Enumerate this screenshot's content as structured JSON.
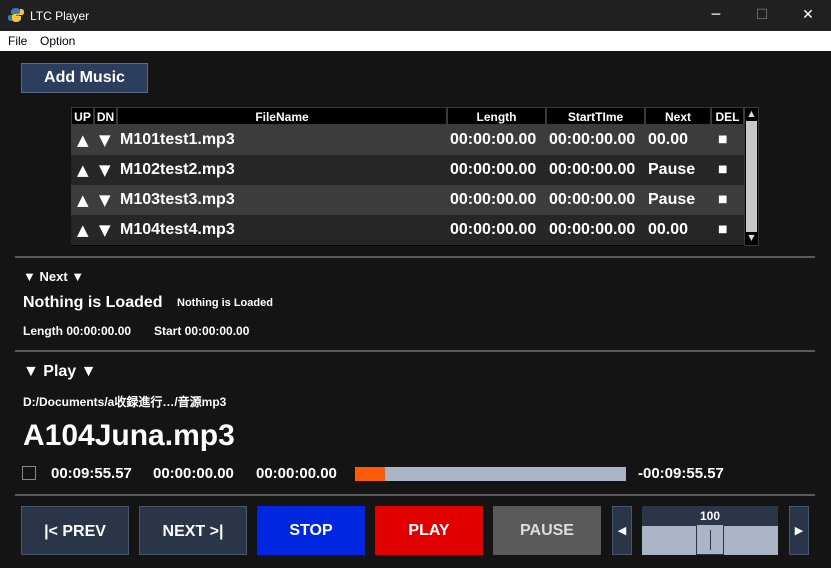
{
  "window": {
    "title": "LTC Player",
    "minimize_glyph": "─",
    "maximize_glyph": "☐",
    "close_glyph": "✕"
  },
  "menu": {
    "file": "File",
    "option": "Option"
  },
  "add_music_label": "Add Music",
  "table": {
    "headers": {
      "up": "UP",
      "dn": "DN",
      "filename": "FileName",
      "length": "Length",
      "start_time": "StartTIme",
      "next": "Next",
      "del": "DEL"
    },
    "up_glyph": "▲",
    "dn_glyph": "▼",
    "del_glyph": "■",
    "rows": [
      {
        "filename": "M101test1.mp3",
        "length": "00:00:00.00",
        "start_time": "00:00:00.00",
        "next": "00.00"
      },
      {
        "filename": "M102test2.mp3",
        "length": "00:00:00.00",
        "start_time": "00:00:00.00",
        "next": "Pause"
      },
      {
        "filename": "M103test3.mp3",
        "length": "00:00:00.00",
        "start_time": "00:00:00.00",
        "next": "Pause"
      },
      {
        "filename": "M104test4.mp3",
        "length": "00:00:00.00",
        "start_time": "00:00:00.00",
        "next": "00.00"
      }
    ]
  },
  "next_section": {
    "header": "▼ Next ▼",
    "title": "Nothing is Loaded",
    "subtitle": "Nothing is Loaded",
    "length_text": "Length 00:00:00.00",
    "start_text": "Start 00:00:00.00"
  },
  "play_section": {
    "header": "▼ Play ▼",
    "path": "D:/Documents/a收録進行…/音源mp3",
    "current_file": "A104Juna.mp3",
    "time_total": "00:09:55.57",
    "time_a": "00:00:00.00",
    "time_b": "00:00:00.00",
    "time_remaining": "-00:09:55.57",
    "progress_fraction": 0.11
  },
  "transport": {
    "prev": "|< PREV",
    "next": "NEXT >|",
    "stop": "STOP",
    "play": "PLAY",
    "pause": "PAUSE"
  },
  "volume": {
    "value": "100",
    "left_glyph": "◀",
    "right_glyph": "▶"
  },
  "colors": {
    "stop": "#0026e0",
    "play": "#e00000",
    "progress_fill": "#ff5a0a"
  }
}
